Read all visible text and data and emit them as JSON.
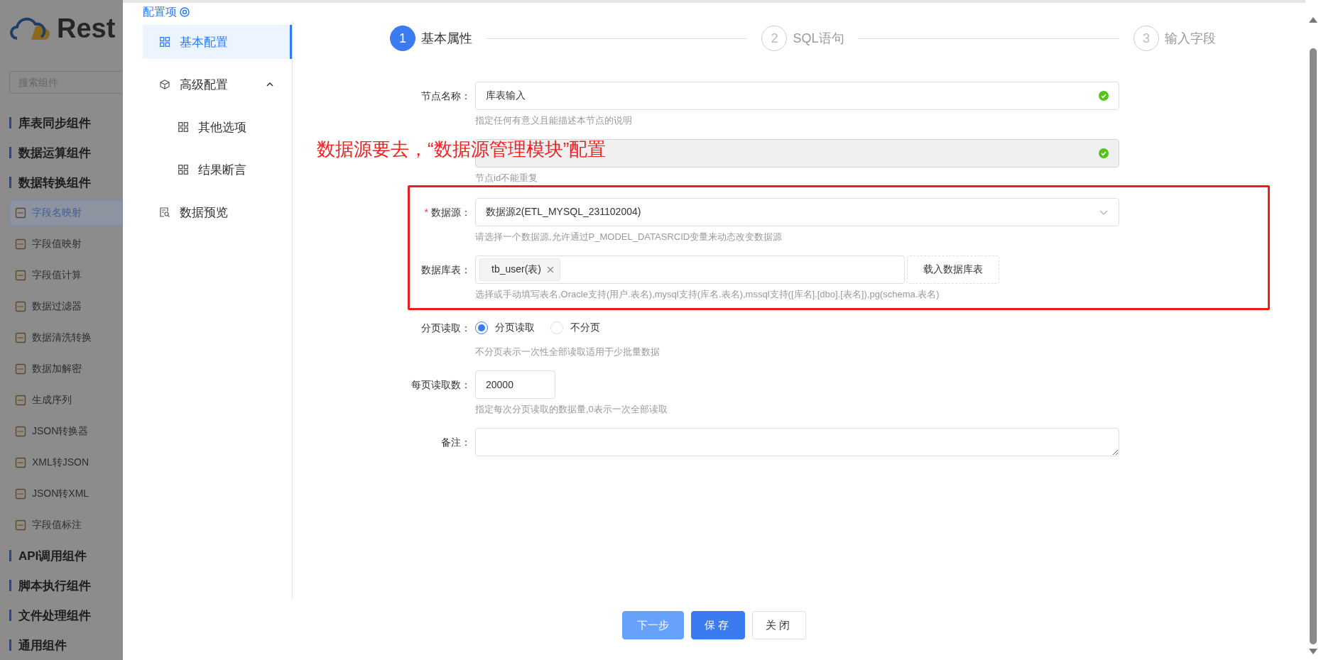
{
  "app_sidebar": {
    "logo_text": "Rest",
    "search": {
      "placeholder": "搜索组件"
    },
    "entries": [
      {
        "kind": "group",
        "label": "库表同步组件"
      },
      {
        "kind": "group",
        "label": "数据运算组件"
      },
      {
        "kind": "group",
        "label": "数据转换组件"
      },
      {
        "kind": "item",
        "label": "字段名映射",
        "selected": true
      },
      {
        "kind": "item",
        "label": "字段值映射",
        "selected": false
      },
      {
        "kind": "item",
        "label": "字段值计算",
        "selected": false
      },
      {
        "kind": "item",
        "label": "数据过滤器",
        "selected": false
      },
      {
        "kind": "item",
        "label": "数据清洗转换",
        "selected": false
      },
      {
        "kind": "item",
        "label": "数据加解密",
        "selected": false
      },
      {
        "kind": "item",
        "label": "生成序列",
        "selected": false
      },
      {
        "kind": "item",
        "label": "JSON转换器",
        "selected": false
      },
      {
        "kind": "item",
        "label": "XML转JSON",
        "selected": false
      },
      {
        "kind": "item",
        "label": "JSON转XML",
        "selected": false
      },
      {
        "kind": "item",
        "label": "字段值标注",
        "selected": false
      },
      {
        "kind": "group",
        "label": "API调用组件"
      },
      {
        "kind": "group",
        "label": "脚本执行组件"
      },
      {
        "kind": "group",
        "label": "文件处理组件"
      },
      {
        "kind": "group",
        "label": "通用组件"
      }
    ]
  },
  "dialog": {
    "title": "配置项",
    "menu": [
      {
        "label": "基本配置",
        "selected": true
      },
      {
        "label": "高级配置",
        "selected": false,
        "expanded": true,
        "children": [
          {
            "label": "其他选项",
            "selected": false
          },
          {
            "label": "结果断言",
            "selected": false
          }
        ]
      },
      {
        "label": "数据预览",
        "selected": false
      }
    ],
    "steps": [
      {
        "number": "1",
        "label": "基本属性",
        "active": true
      },
      {
        "number": "2",
        "label": "SQL语句",
        "active": false
      },
      {
        "number": "3",
        "label": "输入字段",
        "active": false
      }
    ],
    "annotation": "数据源要去，“数据源管理模块”配置",
    "form": [
      {
        "kind": "text",
        "label": "节点名称：",
        "disabled": false,
        "value": "库表输入",
        "valid": true,
        "hint": "指定任何有意义且能描述本节点的说明",
        "highlighted": false
      },
      {
        "kind": "text",
        "disabled": true,
        "valid": true,
        "hint": "节点id不能重复",
        "highlighted": false
      },
      {
        "kind": "select",
        "label": "数据源：",
        "required_mark": "*",
        "value": "数据源2(ETL_MYSQL_231102004)",
        "hint": "请选择一个数据源,允许通过P_MODEL_DATASRCID变量来动态改变数据源",
        "highlighted": true
      },
      {
        "kind": "tags",
        "label": "数据库表：",
        "tags": [
          "tb_user(表)"
        ],
        "button": "载入数据库表",
        "hint": "选择或手动填写表名,Oracle支持(用户.表名),mysql支持(库名.表名),mssql支持([库名].[dbo].[表名]),pg(schema.表名)",
        "highlighted": true
      },
      {
        "kind": "radio",
        "label": "分页读取：",
        "options": [
          {
            "label": "分页读取",
            "selected": true
          },
          {
            "label": "不分页",
            "selected": false
          }
        ],
        "hint": "不分页表示一次性全部读取适用于少批量数据",
        "highlighted": false
      },
      {
        "kind": "number",
        "label": "每页读取数：",
        "value": "20000",
        "hint": "指定每次分页读取的数据量,0表示一次全部读取",
        "highlighted": false
      },
      {
        "kind": "textarea",
        "label": "备注：",
        "highlighted": false
      }
    ],
    "buttons": [
      {
        "label": "下一步",
        "kind": "light"
      },
      {
        "label": "保存",
        "kind": "primary"
      },
      {
        "label": "关闭",
        "kind": "default"
      }
    ]
  }
}
